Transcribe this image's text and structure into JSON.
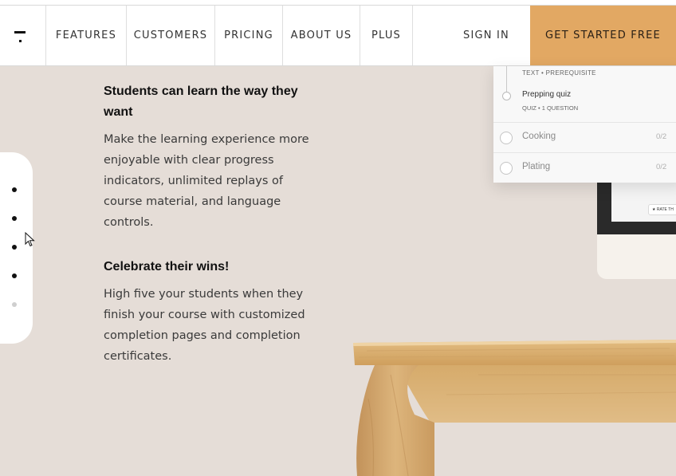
{
  "nav": {
    "items": [
      {
        "label": "FEATURES"
      },
      {
        "label": "CUSTOMERS"
      },
      {
        "label": "PRICING"
      },
      {
        "label": "ABOUT US"
      },
      {
        "label": "PLUS"
      }
    ],
    "sign_in": "SIGN IN",
    "cta": "GET STARTED FREE",
    "logo_icon": "brand-logo-icon"
  },
  "features": [
    {
      "heading": "Students can learn the way they want",
      "body": "Make the learning experience more enjoyable with clear progress indicators, unlimited replays of course material, and language controls."
    },
    {
      "heading": "Celebrate their wins!",
      "body": "High five your students when they finish your course with customized completion pages and completion certificates."
    }
  ],
  "pager": {
    "dots": [
      {
        "state": "active"
      },
      {
        "state": "active"
      },
      {
        "state": "active"
      },
      {
        "state": "active"
      },
      {
        "state": "inactive"
      }
    ]
  },
  "lesson_card": {
    "prev_meta": "TEXT • PREREQUISITE",
    "quiz_title": "Prepping quiz",
    "quiz_meta": "QUIZ • 1 QUESTION",
    "sections": [
      {
        "label": "Cooking",
        "count": "0/2"
      },
      {
        "label": "Plating",
        "count": "0/2"
      }
    ]
  },
  "monitor": {
    "rate_label": "★ RATE TH"
  },
  "colors": {
    "background": "#e5ddd7",
    "cta": "#e2a863",
    "nav_bg": "#ffffff",
    "desk_wood": "#d7ad6f"
  }
}
